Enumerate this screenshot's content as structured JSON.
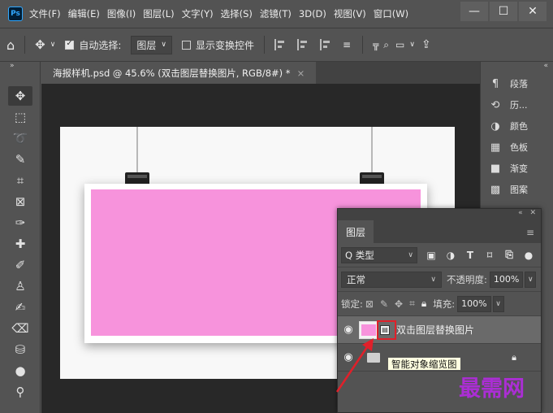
{
  "app": {
    "logo": "Ps"
  },
  "menu": [
    "文件(F)",
    "编辑(E)",
    "图像(I)",
    "图层(L)",
    "文字(Y)",
    "选择(S)",
    "滤镜(T)",
    "3D(D)",
    "视图(V)",
    "窗口(W)"
  ],
  "window_controls": {
    "minimize": "—",
    "maximize": "☐",
    "close": "✕"
  },
  "options": {
    "auto_select_label": "自动选择:",
    "auto_select_checked": true,
    "auto_select_target": "图层",
    "show_transform_label": "显示变换控件",
    "show_transform_checked": false
  },
  "document": {
    "tab_title": "海报样机.psd @ 45.6% (双击图层替换图片, RGB/8#) *",
    "tab_close": "×",
    "photo_color": "#f793dc"
  },
  "right_panel": {
    "items": [
      {
        "icon": "¶",
        "label": "段落"
      },
      {
        "icon": "⟲",
        "label": "历..."
      },
      {
        "icon": "◑",
        "label": "颜色"
      },
      {
        "icon": "▦",
        "label": "色板"
      },
      {
        "icon": "■",
        "label": "渐变"
      },
      {
        "icon": "▩",
        "label": "图案"
      }
    ]
  },
  "layers_panel": {
    "tab": "图层",
    "filter_kind": "Q 类型",
    "blend_mode": "正常",
    "opacity_label": "不透明度:",
    "opacity_value": "100%",
    "lock_label": "锁定:",
    "fill_label": "填充:",
    "fill_value": "100%",
    "layers": [
      {
        "name": "双击图层替换图片",
        "visible": true,
        "selected": true,
        "smart_object": true
      },
      {
        "name": "",
        "visible": true,
        "selected": false,
        "folder": true,
        "locked": true
      }
    ]
  },
  "tooltip": "智能对象缩览图",
  "watermark": "最需网"
}
